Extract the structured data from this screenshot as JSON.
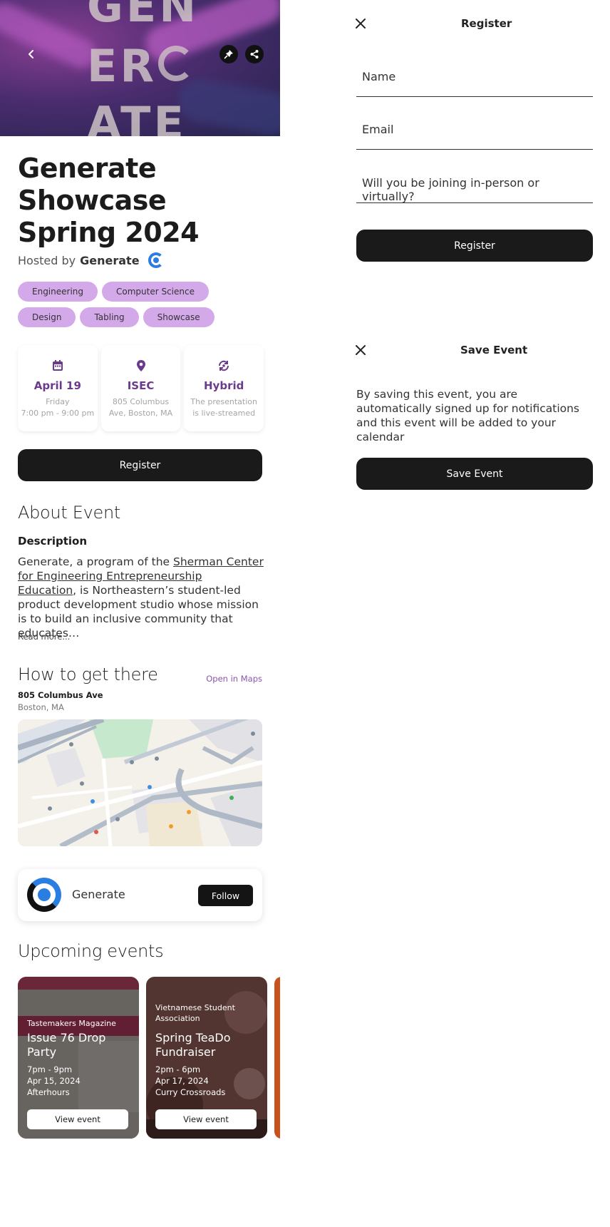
{
  "event": {
    "title": "Generate Showcase Spring 2024",
    "hosted_prefix": "Hosted by",
    "host_name": "Generate",
    "hero_lines": [
      "GEN",
      "ER",
      "ATE"
    ],
    "tags": [
      "Engineering",
      "Computer Science",
      "Design",
      "Tabling",
      "Showcase"
    ],
    "date": {
      "main": "April 19",
      "sub1": "Friday",
      "sub2": "7:00 pm - 9:00 pm"
    },
    "location": {
      "main": "ISEC",
      "sub": "805 Columbus Ave, Boston, MA"
    },
    "mode": {
      "main": "Hybrid",
      "sub": "The presentation is live-streamed"
    },
    "register_label": "Register"
  },
  "about": {
    "heading": "About Event",
    "description_heading": "Description",
    "desc_before": "Generate, a program of the ",
    "desc_link": "Sherman Center for Engineering Entrepreneurship Education",
    "desc_after": ", is Northeastern’s student-led product development studio whose mission is to build an inclusive community that educates…",
    "read_more": "Read more..."
  },
  "directions": {
    "heading": "How to get there",
    "open_maps": "Open in Maps",
    "address_line1": "805 Columbus Ave",
    "address_line2": "Boston, MA"
  },
  "organizer": {
    "name": "Generate",
    "follow_label": "Follow"
  },
  "upcoming": {
    "heading": "Upcoming events",
    "events": [
      {
        "org": "Tastemakers Magazine",
        "title": "Issue 76 Drop Party",
        "time": "7pm - 9pm",
        "date": "Apr 15, 2024",
        "place": "Afterhours",
        "button": "View event"
      },
      {
        "org": "Vietnamese Student Association",
        "title": "Spring TeaDo Fundraiser",
        "time": "2pm - 6pm",
        "date": "Apr 17, 2024",
        "place": "Curry Crossroads",
        "button": "View event"
      }
    ]
  },
  "register_modal": {
    "title": "Register",
    "name_placeholder": "Name",
    "email_placeholder": "Email",
    "attendance_placeholder": "Will you be joining in-person or virtually?",
    "submit_label": "Register"
  },
  "save_modal": {
    "title": "Save Event",
    "message": "By saving this event, you are automatically signed up for notifications and this event will be added to your calendar",
    "submit_label": "Save Event"
  },
  "colors": {
    "accent": "#6b3a8c",
    "tag_bg": "#d4a9ea",
    "dark": "#1a1a1a",
    "brand_blue": "#2a7de1"
  }
}
